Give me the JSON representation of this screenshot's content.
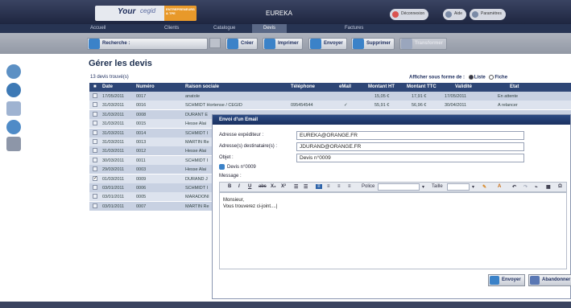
{
  "header": {
    "logo_main": "Your",
    "logo_sub": "cegid",
    "logo_brand": "ENTREPRENEURS & TPE",
    "app_title": "EUREKA",
    "buttons": [
      "Déconnexion",
      "Aide",
      "Paramètres"
    ]
  },
  "nav": {
    "items": [
      "Accueil",
      "Clients",
      "Catalogue",
      "Devis",
      "Factures"
    ],
    "active": "Devis"
  },
  "toolbar": {
    "search_label": "Recherche :",
    "create": "Créer",
    "print": "Imprimer",
    "send": "Envoyer",
    "delete": "Supprimer",
    "disabled": "Transformer"
  },
  "page": {
    "title": "Gérer les devis",
    "count": "13 devis trouvé(s)",
    "display_label": "Afficher sous forme de :",
    "opt_list": "Liste",
    "opt_card": "Fiche"
  },
  "table": {
    "headers": [
      "Date",
      "Numéro",
      "Raison sociale",
      "Téléphone",
      "eMail",
      "Montant HT",
      "Montant TTC",
      "Validité",
      "Etat"
    ],
    "rows": [
      {
        "date": "17/05/2011",
        "num": "0017",
        "name": "anatole",
        "tel": "",
        "mail": "",
        "ht": "15,05 €",
        "ttc": "17,91 €",
        "valid": "17/05/2011",
        "etat": "En attente",
        "checked": false
      },
      {
        "date": "31/03/2011",
        "num": "0016",
        "name": "SCHMIDT Hortense / CEGID",
        "tel": "095454544",
        "mail": "✓",
        "ht": "55,91 €",
        "ttc": "56,96 €",
        "valid": "30/04/2011",
        "etat": "A relancer",
        "checked": false
      },
      {
        "date": "31/03/2011",
        "num": "0008",
        "name": "DURANT E",
        "checked": false
      },
      {
        "date": "31/03/2011",
        "num": "0015",
        "name": "Hesse Alai",
        "checked": false
      },
      {
        "date": "31/03/2011",
        "num": "0014",
        "name": "SCHMIDT I",
        "checked": false
      },
      {
        "date": "31/03/2011",
        "num": "0013",
        "name": "MARTIN Re",
        "checked": false
      },
      {
        "date": "31/03/2011",
        "num": "0012",
        "name": "Hesse Alai",
        "checked": false
      },
      {
        "date": "30/03/2011",
        "num": "0011",
        "name": "SCHMIDT I",
        "checked": false
      },
      {
        "date": "29/03/2011",
        "num": "0003",
        "name": "Hesse Alai",
        "checked": false
      },
      {
        "date": "01/03/2011",
        "num": "0009",
        "name": "DURAND J",
        "checked": true
      },
      {
        "date": "03/01/2011",
        "num": "0006",
        "name": "SCHMIDT I",
        "checked": false
      },
      {
        "date": "03/01/2011",
        "num": "0005",
        "name": "MARADONI",
        "checked": false
      },
      {
        "date": "03/01/2011",
        "num": "0007",
        "name": "MARTIN Re",
        "checked": false
      }
    ]
  },
  "modal": {
    "title": "Envoi d'un Email",
    "from_label": "Adresse expéditeur :",
    "from_value": "EUREKA@ORANGE.FR",
    "to_label": "Adresse(s) destinataire(s) :",
    "to_value": "JDURAND@ORANGE.FR",
    "subject_label": "Objet :",
    "subject_value": "Devis n°0009",
    "attachment": "Devis n°0009",
    "message_label": "Message :",
    "font_label": "Police",
    "size_label": "Taille",
    "body_line1": "Monsieur,",
    "body_line2": "Vous trouverez ci-joint....|",
    "send": "Envoyer",
    "cancel": "Abandonner"
  }
}
